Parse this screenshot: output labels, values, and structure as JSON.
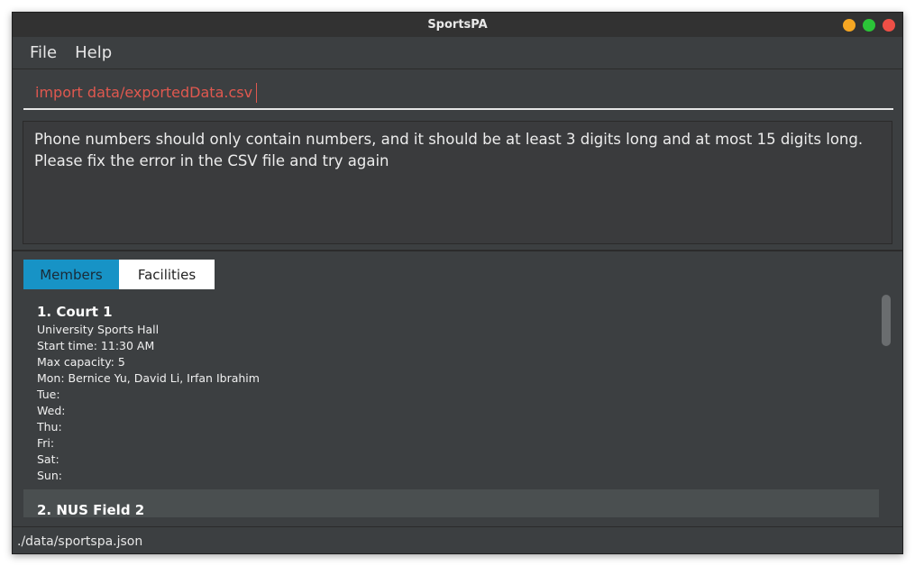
{
  "window": {
    "title": "SportsPA"
  },
  "menubar": {
    "items": [
      "File",
      "Help"
    ]
  },
  "command": {
    "value": "import data/exportedData.csv"
  },
  "result": {
    "lines": [
      "Phone numbers should only contain numbers, and it should be at least 3 digits long and at most 15 digits long.",
      "Please fix the error in the CSV file and try again"
    ]
  },
  "tabs": {
    "members": "Members",
    "facilities": "Facilities"
  },
  "facilities": [
    {
      "title": "1. Court 1",
      "lines": [
        "University Sports Hall",
        "Start time: 11:30 AM",
        "Max capacity: 5",
        "Mon: Bernice Yu, David Li, Irfan Ibrahim",
        "Tue:",
        "Wed:",
        "Thu:",
        "Fri:",
        "Sat:",
        "Sun:"
      ]
    },
    {
      "title": "2. NUS Field 2",
      "lines": []
    }
  ],
  "status": {
    "path": "./data/sportspa.json"
  },
  "colors": {
    "error_text": "#e0584f",
    "tab_active": "#1793c6",
    "window_bg": "#3c3f41"
  },
  "icons": [
    "minimize-icon",
    "maximize-icon",
    "close-icon"
  ]
}
